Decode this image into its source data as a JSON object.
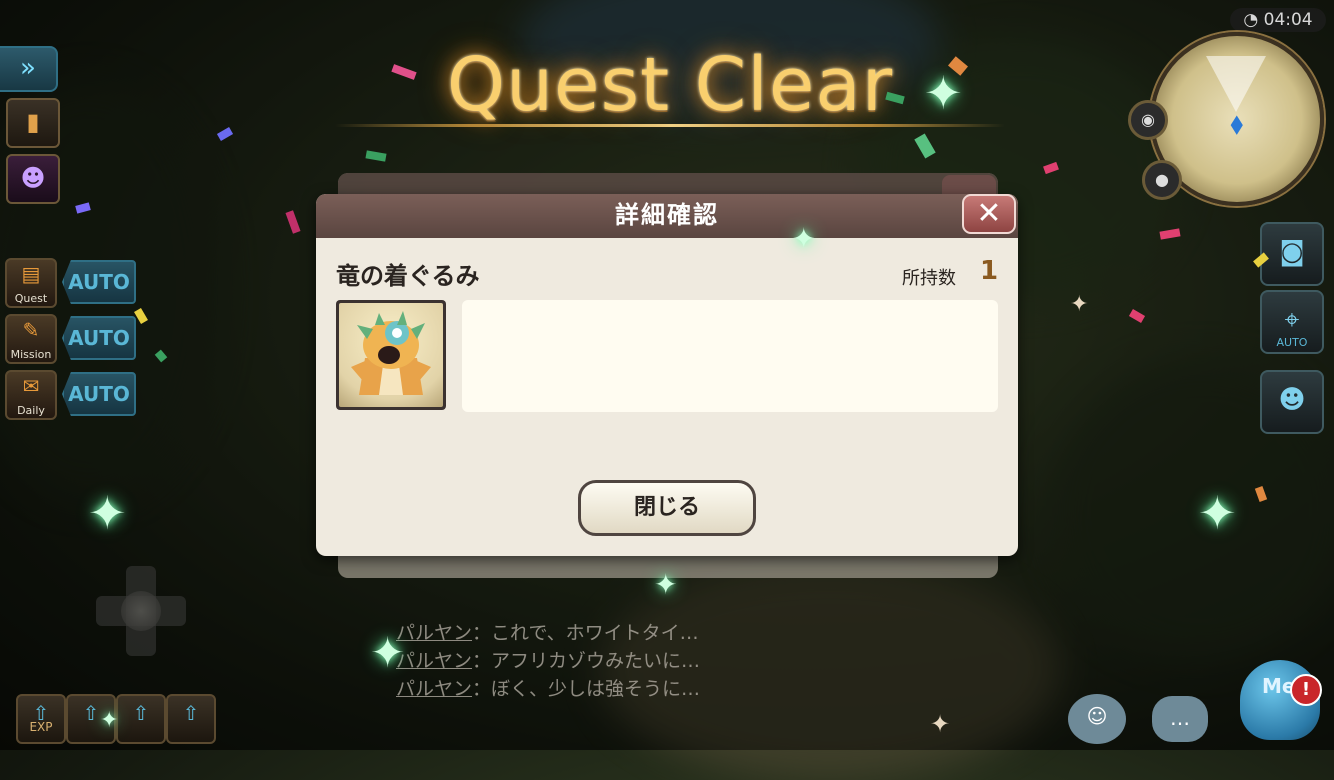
{
  "title": "Quest Clear",
  "clock": "04:04",
  "hud": {
    "fast_forward_glyph": "»",
    "quest_menu": [
      {
        "label": "Quest",
        "auto": "AUTO"
      },
      {
        "label": "Mission",
        "auto": "AUTO"
      },
      {
        "label": "Daily",
        "auto": "AUTO"
      }
    ],
    "exp_label": "EXP",
    "side_buttons": [
      {
        "sub": "AUTO"
      }
    ]
  },
  "dialog": {
    "title": "詳細確認",
    "close_x": "✕",
    "item_name": "竜の着ぐるみ",
    "owned_label": "所持数",
    "owned_count": "1",
    "description": "",
    "close_button": "閉じる"
  },
  "chat_log": [
    {
      "speaker": "パルヤン",
      "text": "：これで、ホワイトタイ…"
    },
    {
      "speaker": "パルヤン",
      "text": "：アフリカゾウみたいに…"
    },
    {
      "speaker": "パルヤン",
      "text": "：ぼく、少しは強そうに…"
    }
  ],
  "mascot_label": "Me",
  "alert_badge": "!",
  "colors": {
    "title_gold": "#f9cf6e",
    "dialog_header": "#6a504a",
    "auto_blue": "#5ab7d6",
    "owned_count": "#8a5a20"
  }
}
